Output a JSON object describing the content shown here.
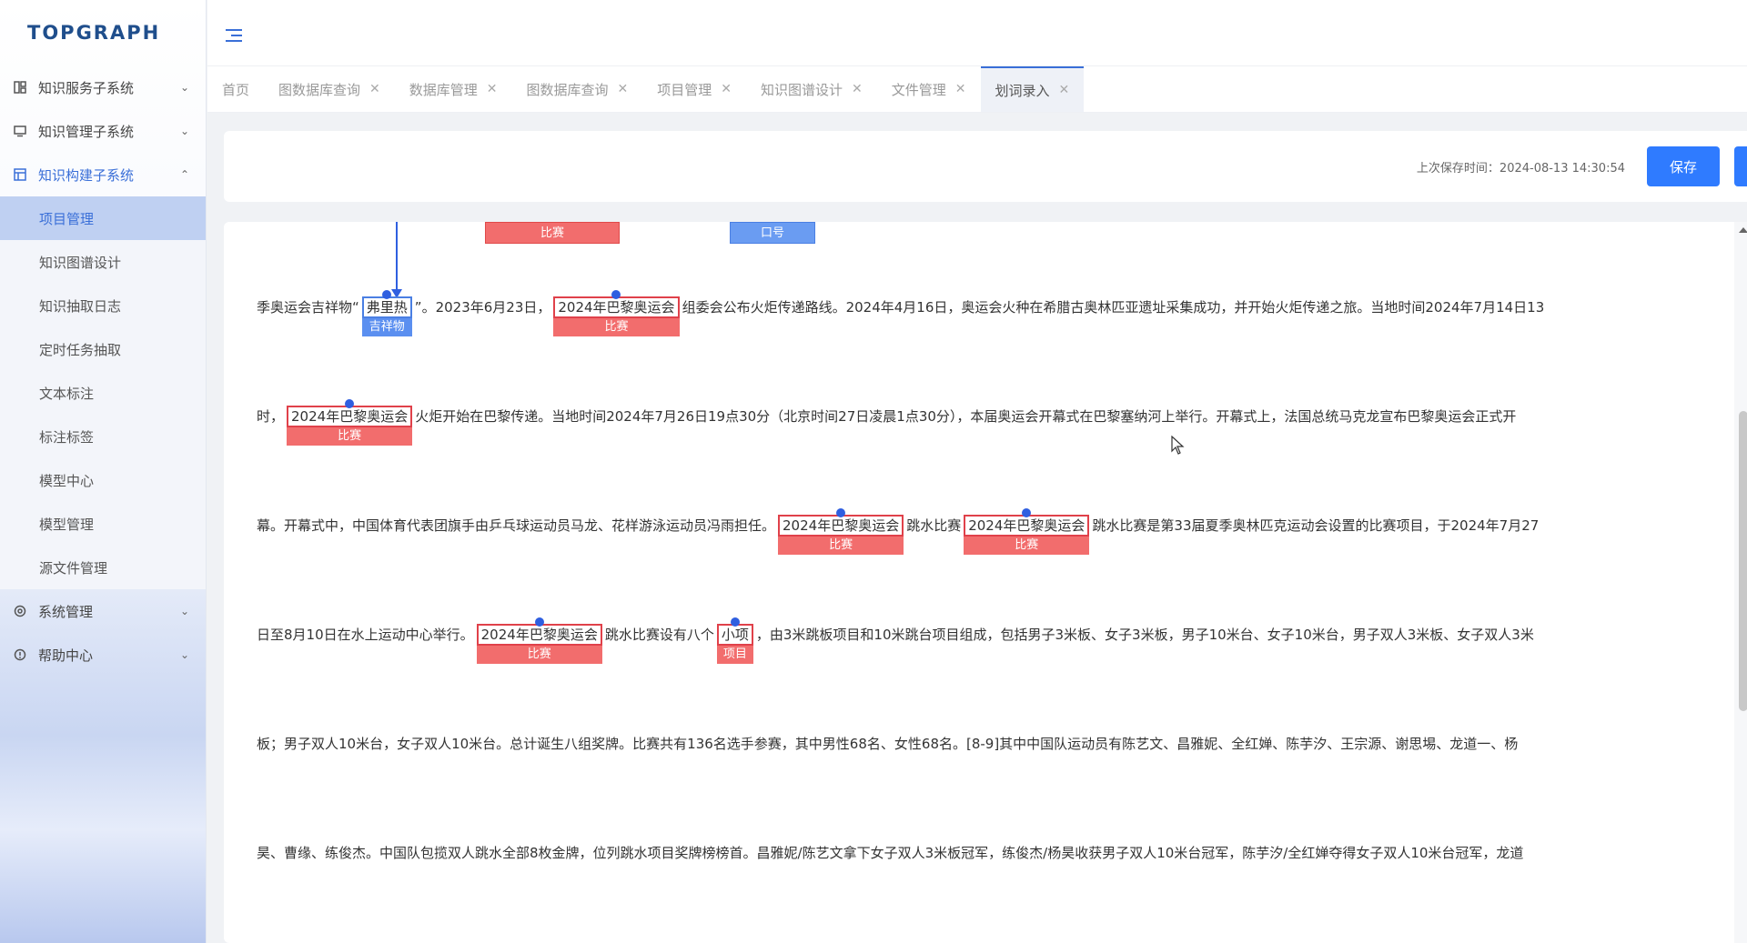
{
  "app": {
    "logo": "TOPGRAPH"
  },
  "sidebar": {
    "groups": [
      {
        "label": "知识服务子系统",
        "icon": "grid-icon",
        "chevron": "⌄"
      },
      {
        "label": "知识管理子系统",
        "icon": "monitor-icon",
        "chevron": "⌄"
      },
      {
        "label": "知识构建子系统",
        "icon": "layout-icon",
        "chevron": "⌃"
      }
    ],
    "sub_items": [
      "项目管理",
      "知识图谱设计",
      "知识抽取日志",
      "定时任务抽取",
      "文本标注",
      "标注标签",
      "模型中心",
      "模型管理",
      "源文件管理"
    ],
    "bottom_groups": [
      {
        "label": "系统管理",
        "icon": "settings-icon",
        "chevron": "⌄"
      },
      {
        "label": "帮助中心",
        "icon": "help-icon",
        "chevron": "⌄"
      }
    ]
  },
  "tabs": [
    {
      "label": "首页",
      "closable": false
    },
    {
      "label": "图数据库查询",
      "closable": true
    },
    {
      "label": "数据库管理",
      "closable": true
    },
    {
      "label": "图数据库查询",
      "closable": true
    },
    {
      "label": "项目管理",
      "closable": true
    },
    {
      "label": "知识图谱设计",
      "closable": true
    },
    {
      "label": "文件管理",
      "closable": true
    },
    {
      "label": "划词录入",
      "closable": true,
      "active": true
    }
  ],
  "toolbar": {
    "save_time_label": "上次保存时间：2024-08-13 14:30:54",
    "save_button": "保存"
  },
  "editor": {
    "top_tags": {
      "match": "比赛",
      "slogan": "口号"
    },
    "line1": {
      "t1": "季奥运会吉祥物“",
      "e1": "弗里热",
      "e1_tag": "吉祥物",
      "t2": "”。2023年6月23日，",
      "e2": "2024年巴黎奥运会",
      "e2_tag": "比赛",
      "t3": "组委会公布火炬传递路线。2024年4月16日，奥运会火种在希腊古奥林匹亚遗址采集成功，并开始火炬传递之旅。当地时间2024年7月14日13"
    },
    "line2": {
      "t1": "时，",
      "e1": "2024年巴黎奥运会",
      "e1_tag": "比赛",
      "t2": "火炬开始在巴黎传递。当地时间2024年7月26日19点30分（北京时间27日凌晨1点30分），本届奥运会开幕式在巴黎塞纳河上举行。开幕式上，法国总统马克龙宣布巴黎奥运会正式开"
    },
    "line3": {
      "t1": "幕。开幕式中，中国体育代表团旗手由乒乓球运动员马龙、花样游泳运动员冯雨担任。",
      "e1": "2024年巴黎奥运会",
      "e1_tag": "比赛",
      "t2": "跳水比赛",
      "e2": "2024年巴黎奥运会",
      "e2_tag": "比赛",
      "t3": "跳水比赛是第33届夏季奥林匹克运动会设置的比赛项目，于2024年7月27"
    },
    "line4": {
      "t1": "日至8月10日在水上运动中心举行。",
      "e1": "2024年巴黎奥运会",
      "e1_tag": "比赛",
      "t2": "跳水比赛设有八个",
      "e2": "小项",
      "e2_tag": "项目",
      "t3": "，由3米跳板项目和10米跳台项目组成，包括男子3米板、女子3米板，男子10米台、女子10米台，男子双人3米板、女子双人3米"
    },
    "line5": "板；男子双人10米台，女子双人10米台。总计诞生八组奖牌。比赛共有136名选手参赛，其中男性68名、女性68名。[8-9]其中中国队运动员有陈艺文、昌雅妮、全红婵、陈芋汐、王宗源、谢思埸、龙道一、杨",
    "line6": "昊、曹缘、练俊杰。中国队包揽双人跳水全部8枚金牌，位列跳水项目奖牌榜榜首。昌雅妮/陈艺文拿下女子双人3米板冠军，练俊杰/杨昊收获男子双人10米台冠军，陈芋汐/全红婵夺得女子双人10米台冠军，龙道"
  }
}
